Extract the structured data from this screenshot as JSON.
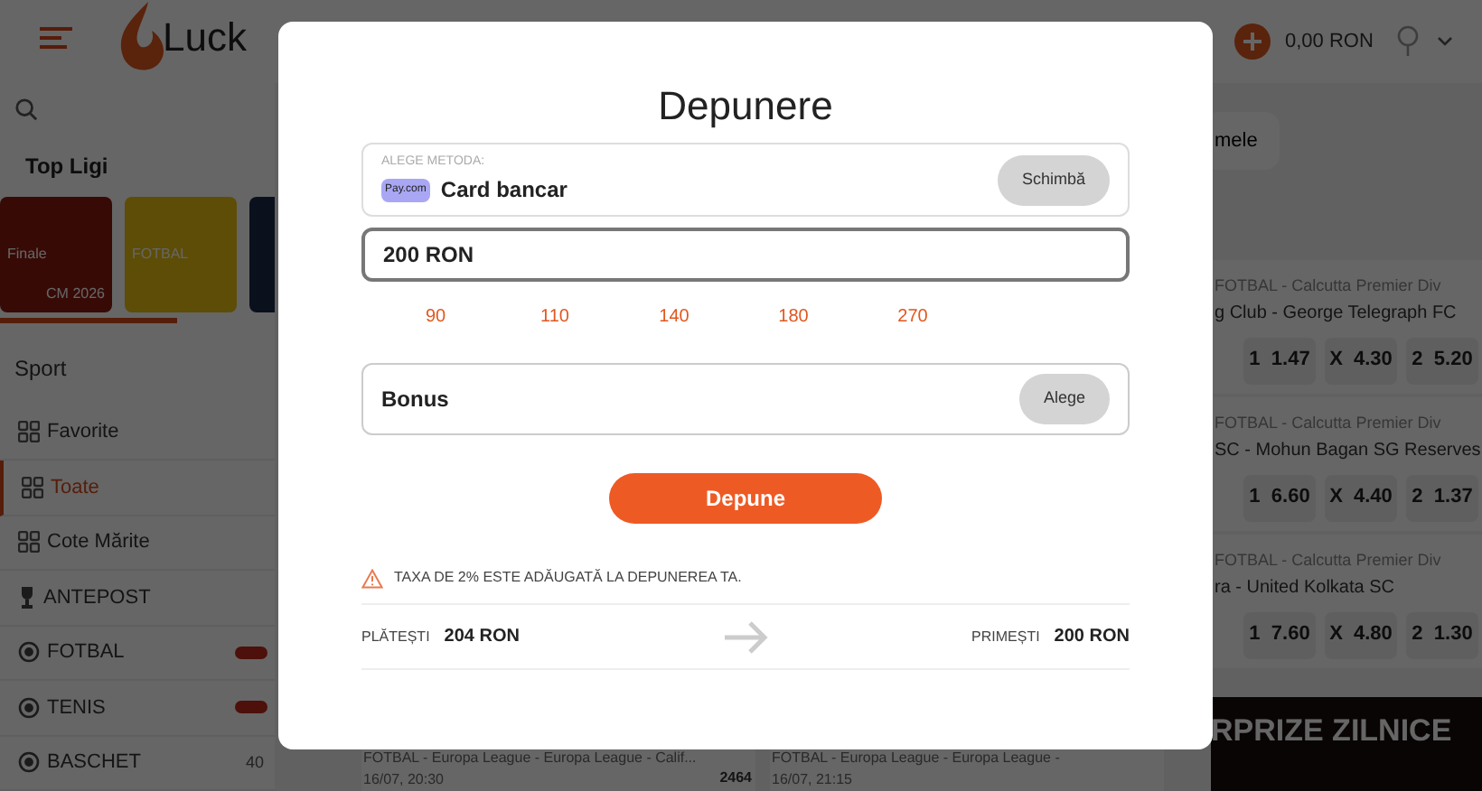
{
  "header": {
    "logo": "Luck",
    "balance": "0,00 RON"
  },
  "sidebar": {
    "section_title": "Top Ligi",
    "league_cards": [
      {
        "label": "Finale",
        "badge": "CM 2026",
        "kind": "final"
      },
      {
        "label": "FOTBAL",
        "kind": "league"
      }
    ],
    "sport_title": "Sport",
    "items": [
      {
        "label": "Favorite",
        "kind": "grid",
        "selected": false
      },
      {
        "label": "Toate",
        "kind": "grid",
        "selected": true
      },
      {
        "label": "Cote Mărite",
        "kind": "grid",
        "selected": false
      },
      {
        "label": "ANTEPOST",
        "kind": "trophy",
        "selected": false
      },
      {
        "label": "FOTBAL",
        "kind": "ball",
        "selected": false,
        "badge": true
      },
      {
        "label": "TENIS",
        "kind": "ball",
        "selected": false,
        "badge": true
      },
      {
        "label": "BASCHET",
        "kind": "ball",
        "selected": false,
        "count": "40"
      }
    ]
  },
  "main": {
    "chip": "mele",
    "matches": [
      {
        "league": "FOTBAL - Calcutta Premier Div",
        "teams": "g Club - George Telegraph FC",
        "odds": [
          "1  1.47",
          "X  4.30",
          "2  5.20"
        ]
      },
      {
        "league": "FOTBAL - Calcutta Premier Div",
        "teams": "SC - Mohun Bagan SG Reserves",
        "odds": [
          "1  6.60",
          "X  4.40",
          "2  1.37"
        ]
      },
      {
        "league": "FOTBAL - Calcutta Premier Div",
        "teams": "ra - United Kolkata SC",
        "odds": [
          "1  7.60",
          "X  4.80",
          "2  1.30"
        ]
      }
    ],
    "banner": "RPRIZE ZILNICE",
    "bottom_events": [
      {
        "league": "FOTBAL - Europa League - Europa League - Calif...",
        "time": "16/07, 20:30",
        "code": "2464"
      },
      {
        "league": "FOTBAL - Europa League - Europa League -",
        "time": "16/07, 21:15"
      }
    ]
  },
  "modal": {
    "title": "Depunere",
    "method": {
      "label": "ALEGE METODA:",
      "logo": "Pay.com",
      "name": "Card bancar",
      "button": "Schimbă"
    },
    "amount": "200 RON",
    "quick_amounts": [
      "90",
      "110",
      "140",
      "180",
      "270"
    ],
    "bonus": {
      "label": "Bonus",
      "button": "Alege"
    },
    "submit": "Depune",
    "notice": "TAXA DE 2% ESTE ADĂUGATĂ LA DEPUNEREA TA.",
    "pay": {
      "label": "PLĂTEȘTI",
      "value": "204 RON"
    },
    "receive": {
      "label": "PRIMEȘTI",
      "value": "200 RON"
    }
  }
}
